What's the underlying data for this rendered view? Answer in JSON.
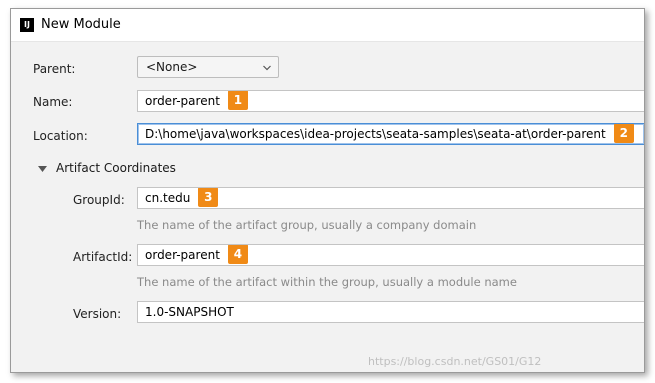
{
  "window": {
    "title": "New Module",
    "app_icon": "IJ"
  },
  "form": {
    "parent": {
      "label": "Parent:",
      "value": "<None>"
    },
    "name": {
      "label": "Name:",
      "value": "order-parent",
      "badge": "1"
    },
    "location": {
      "label": "Location:",
      "value": "D:\\home\\java\\workspaces\\idea-projects\\seata-samples\\seata-at\\order-parent",
      "badge": "2"
    },
    "artifact_section": {
      "title": "Artifact Coordinates"
    },
    "group_id": {
      "label": "GroupId:",
      "value": "cn.tedu",
      "badge": "3",
      "hint": "The name of the artifact group, usually a company domain"
    },
    "artifact_id": {
      "label": "ArtifactId:",
      "value": "order-parent",
      "badge": "4",
      "hint": "The name of the artifact within the group, usually a module name"
    },
    "version": {
      "label": "Version:",
      "value": "1.0-SNAPSHOT"
    }
  },
  "watermark": "https://blog.csdn.net/GS01/G12",
  "colors": {
    "badge": "#f08a16",
    "focus": "#4a8ed6",
    "dialog_bg": "#f2f2f2"
  }
}
